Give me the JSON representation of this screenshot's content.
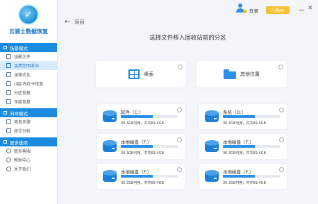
{
  "app": {
    "name": "云骑士数据恢复",
    "logo_glyph": "✓",
    "brand_color": "#1b8be0"
  },
  "topbar": {
    "login_label": "登录",
    "vip_label": "开通VIP",
    "close_glyph": "✕"
  },
  "sidebar": {
    "sections": [
      {
        "title": "场景模式",
        "items": [
          {
            "label": "误删文件",
            "icon": "file-icon",
            "active": false
          },
          {
            "label": "误清空回收站",
            "icon": "recycle-bin-icon",
            "active": true
          },
          {
            "label": "误格式化",
            "icon": "format-icon",
            "active": false
          },
          {
            "label": "U盘/内存卡恢复",
            "icon": "usb-icon",
            "active": false
          },
          {
            "label": "分区恢复",
            "icon": "partition-icon",
            "active": false
          },
          {
            "label": "深度恢复",
            "icon": "deep-scan-icon",
            "active": false
          }
        ]
      },
      {
        "title": "向导模式",
        "items": [
          {
            "label": "简单步骤",
            "icon": "steps-icon",
            "active": false
          },
          {
            "label": "按位分析",
            "icon": "analysis-icon",
            "active": false
          }
        ]
      },
      {
        "title": "更多选项",
        "items": [
          {
            "label": "联系客服",
            "icon": "support-icon",
            "active": false
          },
          {
            "label": "帮助中心",
            "icon": "help-icon",
            "active": false
          },
          {
            "label": "关于我们",
            "icon": "about-icon",
            "active": false
          }
        ]
      }
    ]
  },
  "main": {
    "back_label": "返回",
    "back_glyph": "←",
    "title": "选择文件移入回收站前的分区",
    "locations": [
      {
        "label": "桌面",
        "icon": "windows-icon"
      },
      {
        "label": "其他位置",
        "icon": "folder-icon"
      }
    ],
    "disks": [
      {
        "name": "软件（C:）",
        "info": "30.3GB可用，共共69.4GB",
        "usage": 0.56
      },
      {
        "name": "系统（D:）",
        "info": "30.3GB可用，共共69.4GB",
        "usage": 0.56
      },
      {
        "name": "本地磁盘（F:）",
        "info": "30.3GB可用，共共69.4GB",
        "usage": 0.56
      },
      {
        "name": "本地磁盘（F:）",
        "info": "30.3GB可用，共共69.4GB",
        "usage": 0.56
      },
      {
        "name": "本地磁盘（F:）",
        "info": "30.3GB可用，共共69.4GB",
        "usage": 0.56
      },
      {
        "name": "本地磁盘（F:）",
        "info": "30.3GB可用，共共69.4GB",
        "usage": 0.56
      }
    ]
  }
}
